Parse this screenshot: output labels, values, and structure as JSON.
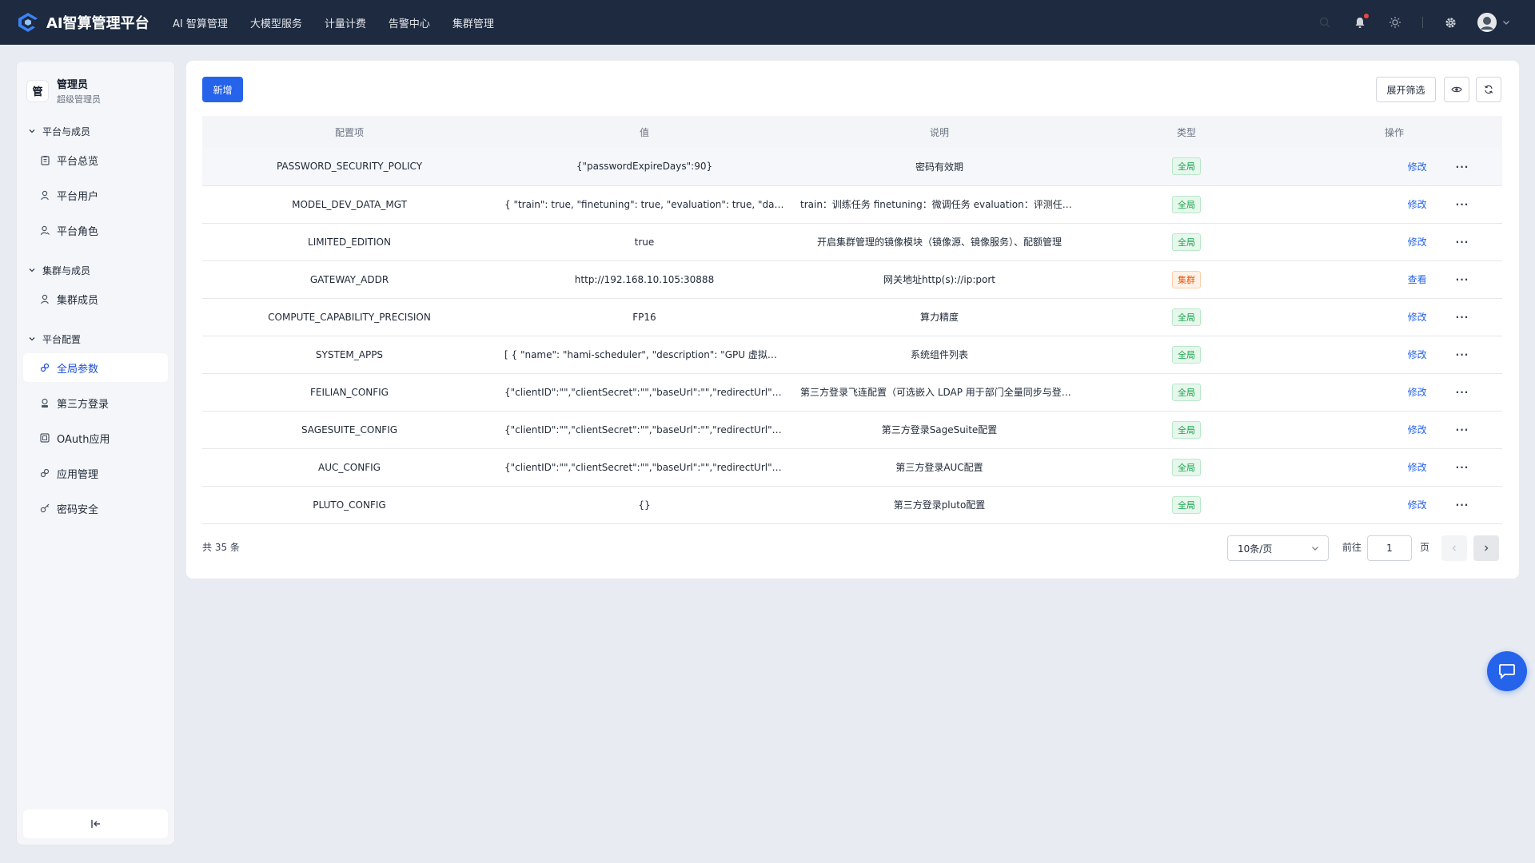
{
  "brand": {
    "title": "AI智算管理平台"
  },
  "nav": {
    "items": [
      "AI 智算管理",
      "大模型服务",
      "计量计费",
      "告警中心",
      "集群管理"
    ]
  },
  "colors": {
    "topbar": "#1d2a3f",
    "primary": "#2563eb",
    "tag_global": "#16a34a",
    "tag_cluster": "#ea580c"
  },
  "user": {
    "avatar_text": "管",
    "name": "管理员",
    "role": "超级管理员"
  },
  "sidebar": {
    "groups": [
      {
        "title": "平台与成员",
        "items": [
          {
            "label": "平台总览",
            "icon": "clipboard-icon"
          },
          {
            "label": "平台用户",
            "icon": "user-icon"
          },
          {
            "label": "平台角色",
            "icon": "user-role-icon"
          }
        ]
      },
      {
        "title": "集群与成员",
        "items": [
          {
            "label": "集群成员",
            "icon": "user-icon"
          }
        ]
      },
      {
        "title": "平台配置",
        "items": [
          {
            "label": "全局参数",
            "icon": "link-icon",
            "active": true
          },
          {
            "label": "第三方登录",
            "icon": "badge-icon"
          },
          {
            "label": "OAuth应用",
            "icon": "app-icon"
          },
          {
            "label": "应用管理",
            "icon": "link-icon"
          },
          {
            "label": "密码安全",
            "icon": "key-icon"
          }
        ]
      }
    ]
  },
  "toolbar": {
    "add_label": "新增",
    "filter_label": "展开筛选"
  },
  "table": {
    "headers": [
      "配置项",
      "值",
      "说明",
      "类型",
      "操作"
    ],
    "rows": [
      {
        "key": "PASSWORD_SECURITY_POLICY",
        "value": "{\"passwordExpireDays\":90}",
        "desc": "密码有效期",
        "type": "全局",
        "action": "修改"
      },
      {
        "key": "MODEL_DEV_DATA_MGT",
        "value": "{ \"train\": true, \"finetuning\": true, \"evaluation\": true, \"dataset\": true }",
        "desc": "train：训练任务 finetuning：微调任务 evaluation：评测任务 dataset：数据集",
        "type": "全局",
        "action": "修改"
      },
      {
        "key": "LIMITED_EDITION",
        "value": "true",
        "desc": "开启集群管理的镜像模块（镜像源、镜像服务）、配额管理",
        "type": "全局",
        "action": "修改"
      },
      {
        "key": "GATEWAY_ADDR",
        "value": "http://192.168.10.105:30888",
        "desc": "网关地址http(s)://ip:port",
        "type": "集群",
        "action": "查看"
      },
      {
        "key": "COMPUTE_CAPABILITY_PRECISION",
        "value": "FP16",
        "desc": "算力精度",
        "type": "全局",
        "action": "修改"
      },
      {
        "key": "SYSTEM_APPS",
        "value": "[ { \"name\": \"hami-scheduler\", \"description\": \"GPU 虚拟化的调度器\" } ]",
        "desc": "系统组件列表",
        "type": "全局",
        "action": "修改"
      },
      {
        "key": "FEILIAN_CONFIG",
        "value": "{\"clientID\":\"\",\"clientSecret\":\"\",\"baseUrl\":\"\",\"redirectUrl\":\"\",\"isDepartmentSync\":false}",
        "desc": "第三方登录飞连配置（可选嵌入 LDAP 用于部门全量同步与登录验证）",
        "type": "全局",
        "action": "修改"
      },
      {
        "key": "SAGESUITE_CONFIG",
        "value": "{\"clientID\":\"\",\"clientSecret\":\"\",\"baseUrl\":\"\",\"redirectUrl\":\"\"}",
        "desc": "第三方登录SageSuite配置",
        "type": "全局",
        "action": "修改"
      },
      {
        "key": "AUC_CONFIG",
        "value": "{\"clientID\":\"\",\"clientSecret\":\"\",\"baseUrl\":\"\",\"redirectUrl\":\"\"}",
        "desc": "第三方登录AUC配置",
        "type": "全局",
        "action": "修改"
      },
      {
        "key": "PLUTO_CONFIG",
        "value": "{}",
        "desc": "第三方登录pluto配置",
        "type": "全局",
        "action": "修改"
      }
    ]
  },
  "pagination": {
    "total_label": "共 35 条",
    "page_size": "10条/页",
    "goto_label": "前往",
    "current_page": "1",
    "page_label": "页"
  }
}
